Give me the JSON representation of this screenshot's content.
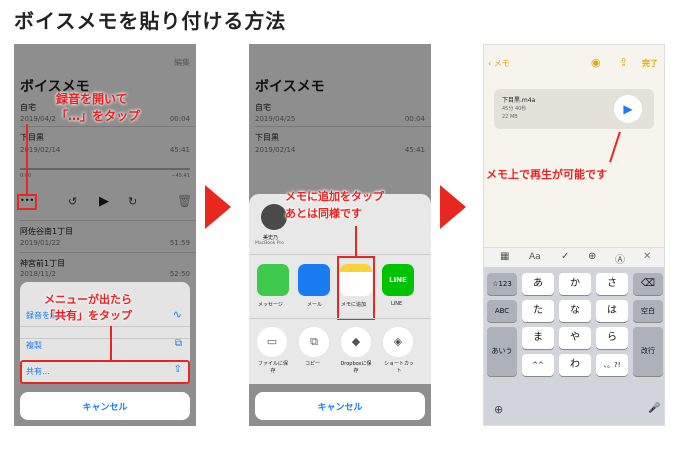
{
  "page_title": "ボイスメモを貼り付ける方法",
  "panel1": {
    "edit_label": "編集",
    "app_title": "ボイスメモ",
    "recordings": [
      {
        "title": "自宅",
        "date": "2019/04/2",
        "duration": "00:04"
      },
      {
        "title": "下目黒",
        "date": "2019/02/14",
        "duration": "45:41"
      },
      {
        "title": "阿佐谷南1丁目",
        "date": "2019/01/22",
        "duration": "51:59"
      },
      {
        "title": "神宮前1丁目",
        "date": "2018/11/2",
        "duration": "52:50"
      }
    ],
    "player": {
      "elapsed": "0:00",
      "remaining": "−45:41",
      "more": "•••"
    },
    "callout_top": "録音を開いて\n「…」をタップ",
    "callout_bottom": "メニューが出たら\n「共有」をタップ",
    "menu_items": [
      "録音を編集",
      "複製",
      "共有..."
    ],
    "cancel": "キャンセル"
  },
  "panel2": {
    "app_title": "ボイスメモ",
    "recordings": [
      {
        "title": "自宅",
        "date": "2019/04/25",
        "duration": "00:04"
      },
      {
        "title": "下目黒",
        "date": "2019/02/14",
        "duration": "45:41"
      }
    ],
    "callout": "メモに追加をタップ\nあとは同様です",
    "airdrop_name": "美史乃",
    "airdrop_device": "MacBook Pro",
    "apps": [
      "メッセージ",
      "メール",
      "メモに追加",
      "LINE"
    ],
    "actions": [
      "ファイルに保存",
      "コピー",
      "Dropboxに保存",
      "ショートカット"
    ],
    "cancel": "キャンセル"
  },
  "panel3": {
    "back": "メモ",
    "done": "完了",
    "file_name": "下目黒.m4a",
    "file_duration": "45分 40秒",
    "file_size": "22 MB",
    "callout": "メモ上で再生が可能です",
    "toolbar": [
      "▦",
      "Aa",
      "✓",
      "⊕",
      "Ⓐ",
      "✕"
    ],
    "keys": {
      "row1": [
        "あ",
        "か",
        "さ"
      ],
      "row2": [
        "た",
        "な",
        "は"
      ],
      "row3": [
        "ま",
        "や",
        "ら"
      ],
      "row4": [
        "^^",
        "わ",
        "、。?!"
      ],
      "left": [
        "☆123",
        "ABC",
        "あいう"
      ],
      "right": [
        "⌫",
        "空白",
        "改行"
      ]
    }
  },
  "colors": {
    "accent_red": "#e8271f",
    "ios_blue": "#1b7cf2",
    "notes_yellow": "#e2a800"
  }
}
